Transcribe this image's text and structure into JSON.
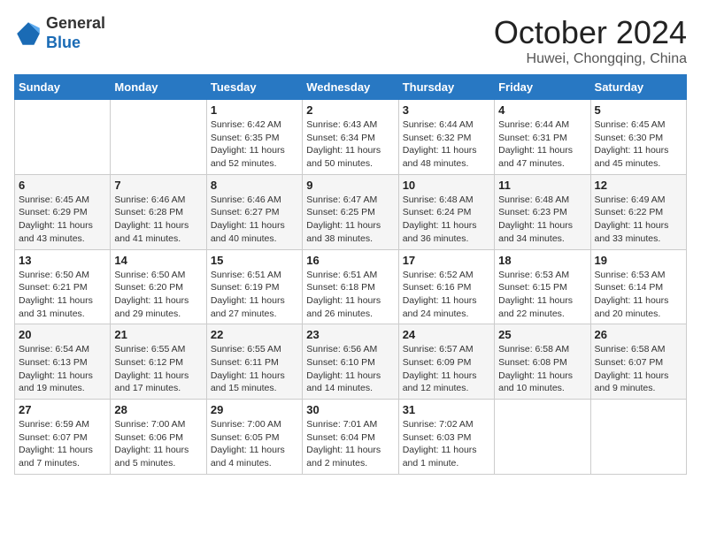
{
  "header": {
    "logo_general": "General",
    "logo_blue": "Blue",
    "month": "October 2024",
    "location": "Huwei, Chongqing, China"
  },
  "columns": [
    "Sunday",
    "Monday",
    "Tuesday",
    "Wednesday",
    "Thursday",
    "Friday",
    "Saturday"
  ],
  "weeks": [
    [
      {
        "day": "",
        "info": ""
      },
      {
        "day": "",
        "info": ""
      },
      {
        "day": "1",
        "info": "Sunrise: 6:42 AM\nSunset: 6:35 PM\nDaylight: 11 hours and 52 minutes."
      },
      {
        "day": "2",
        "info": "Sunrise: 6:43 AM\nSunset: 6:34 PM\nDaylight: 11 hours and 50 minutes."
      },
      {
        "day": "3",
        "info": "Sunrise: 6:44 AM\nSunset: 6:32 PM\nDaylight: 11 hours and 48 minutes."
      },
      {
        "day": "4",
        "info": "Sunrise: 6:44 AM\nSunset: 6:31 PM\nDaylight: 11 hours and 47 minutes."
      },
      {
        "day": "5",
        "info": "Sunrise: 6:45 AM\nSunset: 6:30 PM\nDaylight: 11 hours and 45 minutes."
      }
    ],
    [
      {
        "day": "6",
        "info": "Sunrise: 6:45 AM\nSunset: 6:29 PM\nDaylight: 11 hours and 43 minutes."
      },
      {
        "day": "7",
        "info": "Sunrise: 6:46 AM\nSunset: 6:28 PM\nDaylight: 11 hours and 41 minutes."
      },
      {
        "day": "8",
        "info": "Sunrise: 6:46 AM\nSunset: 6:27 PM\nDaylight: 11 hours and 40 minutes."
      },
      {
        "day": "9",
        "info": "Sunrise: 6:47 AM\nSunset: 6:25 PM\nDaylight: 11 hours and 38 minutes."
      },
      {
        "day": "10",
        "info": "Sunrise: 6:48 AM\nSunset: 6:24 PM\nDaylight: 11 hours and 36 minutes."
      },
      {
        "day": "11",
        "info": "Sunrise: 6:48 AM\nSunset: 6:23 PM\nDaylight: 11 hours and 34 minutes."
      },
      {
        "day": "12",
        "info": "Sunrise: 6:49 AM\nSunset: 6:22 PM\nDaylight: 11 hours and 33 minutes."
      }
    ],
    [
      {
        "day": "13",
        "info": "Sunrise: 6:50 AM\nSunset: 6:21 PM\nDaylight: 11 hours and 31 minutes."
      },
      {
        "day": "14",
        "info": "Sunrise: 6:50 AM\nSunset: 6:20 PM\nDaylight: 11 hours and 29 minutes."
      },
      {
        "day": "15",
        "info": "Sunrise: 6:51 AM\nSunset: 6:19 PM\nDaylight: 11 hours and 27 minutes."
      },
      {
        "day": "16",
        "info": "Sunrise: 6:51 AM\nSunset: 6:18 PM\nDaylight: 11 hours and 26 minutes."
      },
      {
        "day": "17",
        "info": "Sunrise: 6:52 AM\nSunset: 6:16 PM\nDaylight: 11 hours and 24 minutes."
      },
      {
        "day": "18",
        "info": "Sunrise: 6:53 AM\nSunset: 6:15 PM\nDaylight: 11 hours and 22 minutes."
      },
      {
        "day": "19",
        "info": "Sunrise: 6:53 AM\nSunset: 6:14 PM\nDaylight: 11 hours and 20 minutes."
      }
    ],
    [
      {
        "day": "20",
        "info": "Sunrise: 6:54 AM\nSunset: 6:13 PM\nDaylight: 11 hours and 19 minutes."
      },
      {
        "day": "21",
        "info": "Sunrise: 6:55 AM\nSunset: 6:12 PM\nDaylight: 11 hours and 17 minutes."
      },
      {
        "day": "22",
        "info": "Sunrise: 6:55 AM\nSunset: 6:11 PM\nDaylight: 11 hours and 15 minutes."
      },
      {
        "day": "23",
        "info": "Sunrise: 6:56 AM\nSunset: 6:10 PM\nDaylight: 11 hours and 14 minutes."
      },
      {
        "day": "24",
        "info": "Sunrise: 6:57 AM\nSunset: 6:09 PM\nDaylight: 11 hours and 12 minutes."
      },
      {
        "day": "25",
        "info": "Sunrise: 6:58 AM\nSunset: 6:08 PM\nDaylight: 11 hours and 10 minutes."
      },
      {
        "day": "26",
        "info": "Sunrise: 6:58 AM\nSunset: 6:07 PM\nDaylight: 11 hours and 9 minutes."
      }
    ],
    [
      {
        "day": "27",
        "info": "Sunrise: 6:59 AM\nSunset: 6:07 PM\nDaylight: 11 hours and 7 minutes."
      },
      {
        "day": "28",
        "info": "Sunrise: 7:00 AM\nSunset: 6:06 PM\nDaylight: 11 hours and 5 minutes."
      },
      {
        "day": "29",
        "info": "Sunrise: 7:00 AM\nSunset: 6:05 PM\nDaylight: 11 hours and 4 minutes."
      },
      {
        "day": "30",
        "info": "Sunrise: 7:01 AM\nSunset: 6:04 PM\nDaylight: 11 hours and 2 minutes."
      },
      {
        "day": "31",
        "info": "Sunrise: 7:02 AM\nSunset: 6:03 PM\nDaylight: 11 hours and 1 minute."
      },
      {
        "day": "",
        "info": ""
      },
      {
        "day": "",
        "info": ""
      }
    ]
  ]
}
